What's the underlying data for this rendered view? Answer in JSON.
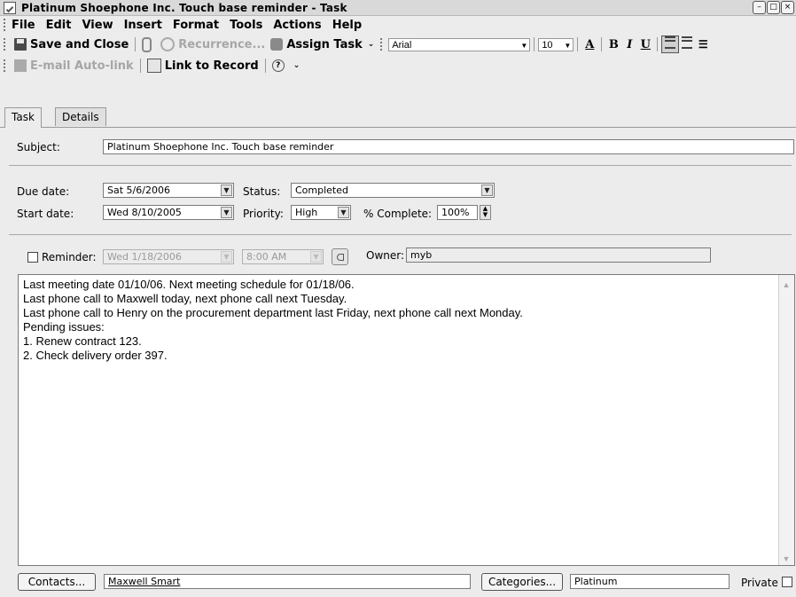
{
  "window": {
    "title": "Platinum Shoephone Inc.  Touch base reminder - Task",
    "buttons": [
      "–",
      "□",
      "×"
    ]
  },
  "menu": [
    "File",
    "Edit",
    "View",
    "Insert",
    "Format",
    "Tools",
    "Actions",
    "Help"
  ],
  "toolbar1": {
    "save_close": "Save and Close",
    "recurrence": "Recurrence...",
    "assign_task": "Assign Task",
    "font_name": "Arial",
    "font_size": "10",
    "bold": "B",
    "italic": "I",
    "underline": "U"
  },
  "toolbar2": {
    "email_autolink": "E-mail Auto-link",
    "link_to_record": "Link to Record"
  },
  "tabs": [
    "Task",
    "Details"
  ],
  "form": {
    "subject_label": "Subject:",
    "subject_value": "Platinum Shoephone Inc.  Touch base reminder",
    "due_label": "Due date:",
    "due_value": "Sat 5/6/2006",
    "start_label": "Start date:",
    "start_value": "Wed 8/10/2005",
    "status_label": "Status:",
    "status_value": "Completed",
    "priority_label": "Priority:",
    "priority_value": "High",
    "complete_label": "% Complete:",
    "complete_value": "100%",
    "reminder_label": "Reminder:",
    "reminder_date": "Wed 1/18/2006",
    "reminder_time": "8:00 AM",
    "owner_label": "Owner:",
    "owner_value": "myb"
  },
  "notes": [
    "Last meeting date 01/10/06. Next meeting schedule for 01/18/06.",
    "Last phone call to Maxwell today, next phone call next Tuesday.",
    "Last phone call to Henry on the procurement department last Friday, next phone call next Monday.",
    "Pending issues:",
    "1. Renew contract 123.",
    "2. Check delivery order 397."
  ],
  "footer": {
    "contacts_button": "Contacts...",
    "contacts_value": "Maxwell Smart",
    "categories_button": "Categories...",
    "categories_value": "Platinum",
    "private_label": "Private"
  }
}
